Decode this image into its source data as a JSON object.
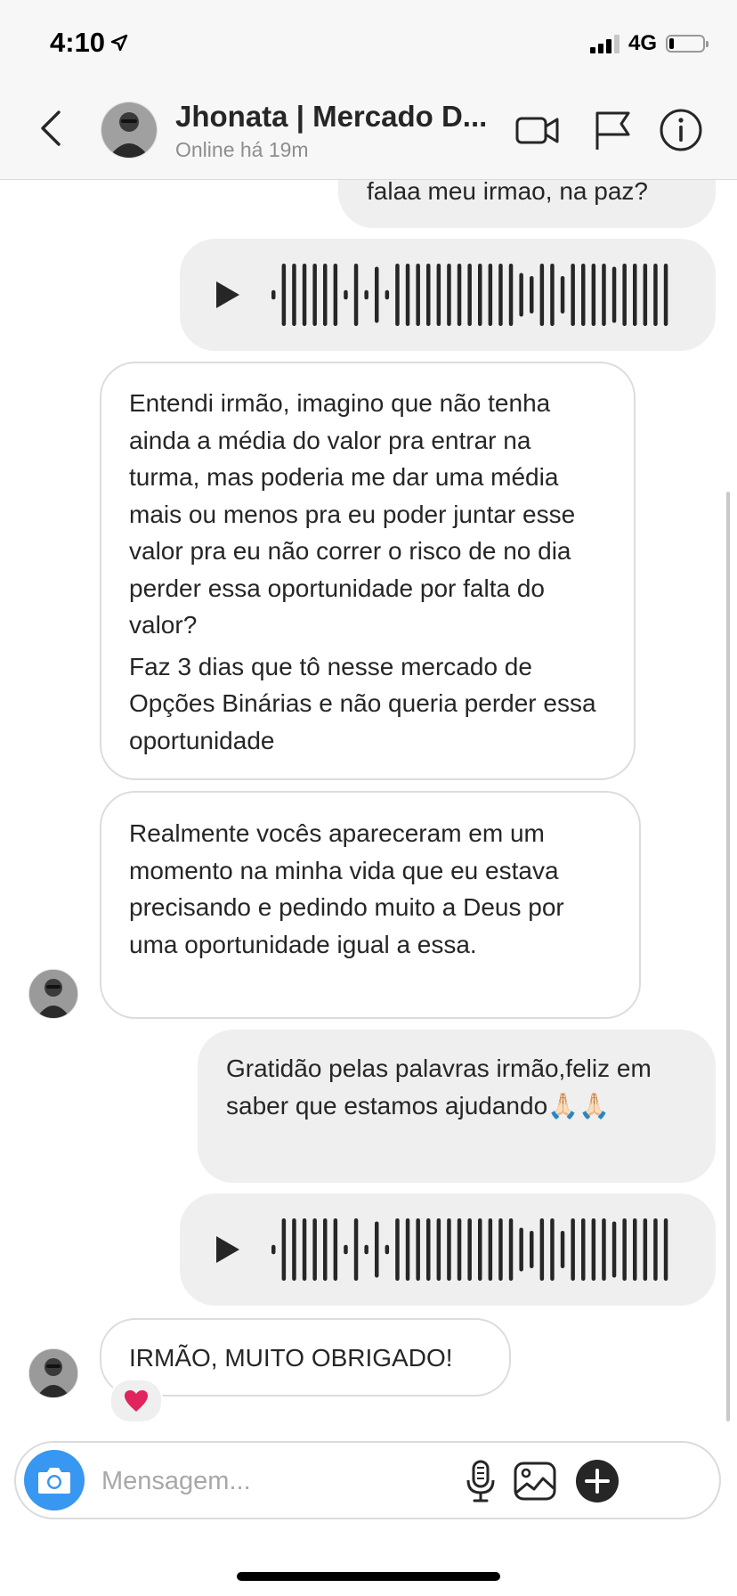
{
  "status_bar": {
    "time": "4:10",
    "network": "4G",
    "signal_bars": 3,
    "battery_level": 0.15
  },
  "header": {
    "contact_name": "Jhonata | Mercado D...",
    "contact_status": "Online há 19m",
    "icons": [
      "back-icon",
      "video-call-icon",
      "flag-icon",
      "info-icon"
    ]
  },
  "messages": {
    "m1": {
      "from": "me",
      "text": "falaa meu irmao, na paz?"
    },
    "m2": {
      "from": "me",
      "type": "audio"
    },
    "m3": {
      "from": "contact",
      "p1": "Entendi irmão, imagino que não tenha ainda a média do valor pra entrar na turma, mas poderia me dar uma média mais ou menos pra eu poder juntar esse valor pra eu não correr o risco de no dia perder essa oportunidade por falta do valor?",
      "p2": "Faz 3 dias que tô nesse mercado de Opções Binárias e não queria perder essa oportunidade"
    },
    "m4": {
      "from": "contact",
      "text": "Realmente vocês apareceram em um momento na minha vida que eu estava precisando e pedindo muito a Deus por uma oportunidade igual a essa."
    },
    "m5": {
      "from": "me",
      "text": "Gratidão pelas palavras irmão,feliz em saber que estamos ajudando🙏🏻🙏🏻"
    },
    "m6": {
      "from": "me",
      "type": "audio"
    },
    "m7": {
      "from": "contact",
      "text": "IRMÃO, MUITO OBRIGADO!",
      "reaction": "heart-icon"
    }
  },
  "composer": {
    "placeholder": "Mensagem...",
    "value": "",
    "icons": [
      "camera-icon",
      "microphone-icon",
      "gallery-icon",
      "add-icon"
    ]
  },
  "colors": {
    "accent": "#3897f0",
    "outgoing_bubble": "#efefef",
    "incoming_border": "#dcdcdc",
    "reaction": "#e0245e"
  }
}
